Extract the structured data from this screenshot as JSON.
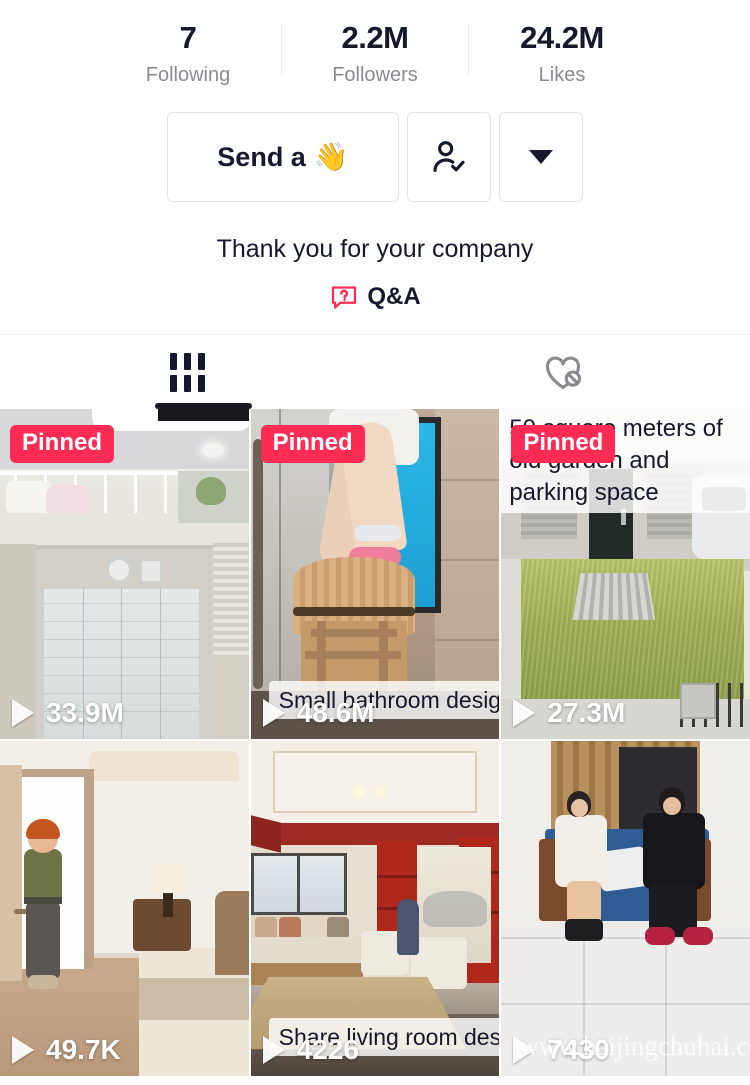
{
  "profile": {
    "stats": [
      {
        "value": "7",
        "label": "Following",
        "name": "following"
      },
      {
        "value": "2.2M",
        "label": "Followers",
        "name": "followers"
      },
      {
        "value": "24.2M",
        "label": "Likes",
        "name": "likes"
      }
    ],
    "buttons": {
      "send_label": "Send a",
      "send_emoji": "👋",
      "follow_icon": "person-check-icon",
      "more_icon": "chevron-down-icon"
    },
    "bio": "Thank you for your company",
    "qa": {
      "label": "Q&A",
      "icon": "question-bubble-icon",
      "color": "#fe2c55"
    }
  },
  "tabs": [
    {
      "name": "videos",
      "icon": "grid-icon",
      "active": true
    },
    {
      "name": "liked-private",
      "icon": "heart-slash-icon",
      "active": false
    }
  ],
  "colors": {
    "accent": "#fe2c55",
    "text_primary": "#16182b",
    "text_secondary": "#8a8b91",
    "border": "#e4e4e6"
  },
  "videos": [
    {
      "pinned_label": "Pinned",
      "pinned": true,
      "views": "33.9M",
      "caption": "",
      "caption_pos": "none"
    },
    {
      "pinned_label": "Pinned",
      "pinned": true,
      "views": "48.6M",
      "caption": "Small bathroom design",
      "caption_pos": "bottom"
    },
    {
      "pinned_label": "Pinned",
      "pinned": true,
      "views": "27.3M",
      "caption": "50 square meters of old garden and parking space",
      "caption_pos": "top"
    },
    {
      "pinned_label": "",
      "pinned": false,
      "views": "49.7K",
      "caption": "",
      "caption_pos": "none"
    },
    {
      "pinned_label": "",
      "pinned": false,
      "views": "4226",
      "caption": "Share living room design",
      "caption_pos": "bottom"
    },
    {
      "pinned_label": "",
      "pinned": false,
      "views": "7430",
      "caption": "",
      "caption_pos": "none",
      "watermark": "www.haijingchuhai.com"
    }
  ]
}
